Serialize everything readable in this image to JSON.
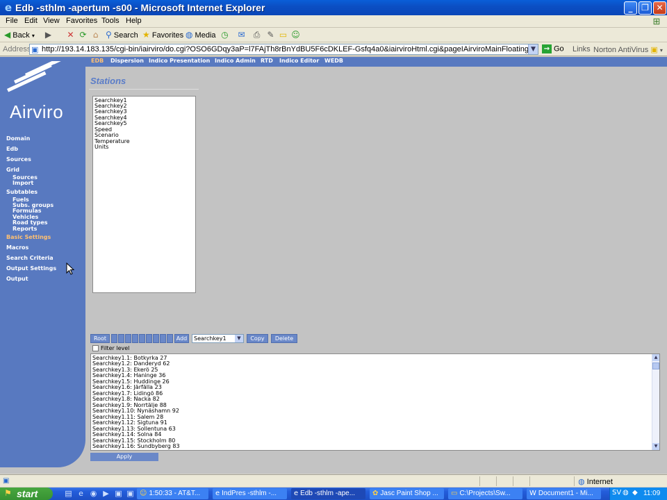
{
  "window": {
    "title": "Edb -sthlm -apertum -s00 - Microsoft Internet Explorer",
    "buttons": [
      "minimize",
      "restore",
      "close"
    ]
  },
  "menu": [
    "File",
    "Edit",
    "View",
    "Favorites",
    "Tools",
    "Help"
  ],
  "toolbar": {
    "back": "Back",
    "search": "Search",
    "favorites": "Favorites",
    "media": "Media"
  },
  "address": {
    "label": "Address",
    "url": "http://193.14.183.135/cgi-bin/iairviro/do.cgi?OSO6GDqy3aP=l7FAjTh8rBnYdBU5F6cDKLEF-Gsfq4a0&iairviroHtml.cgi&pageIAirviroMainFloatingModule&OSO6GDqy3al",
    "go": "Go",
    "links": "Links",
    "norton": "Norton AntiVirus"
  },
  "app": {
    "logo_text": "Airviro",
    "top_nav": [
      "EDB",
      "Dispersion",
      "Indico Presentation",
      "Indico Admin",
      "RTD",
      "Indico Editor",
      "WEDB"
    ],
    "top_nav_active": "EDB",
    "sidebar": {
      "domain": "Domain",
      "edb": "Edb",
      "sources": "Sources",
      "grid": "Grid",
      "grid_sources": "Sources",
      "grid_import": "Import",
      "subtables": "Subtables",
      "fuels": "Fuels",
      "subs_groups": "Subs. groups",
      "formulas": "Formulas",
      "vehicles": "Vehicles",
      "road_types": "Road types",
      "reports": "Reports",
      "basic_settings": "Basic Settings",
      "macros": "Macros",
      "search_criteria": "Search Criteria",
      "output_settings": "Output Settings",
      "output": "Output"
    },
    "page_title": "Stations",
    "stations": [
      "Searchkey1",
      "Searchkey2",
      "Searchkey3",
      "Searchkey4",
      "Searchkey5",
      "Speed",
      "Scenario",
      "Temperature",
      "Units"
    ],
    "controls": {
      "root": "Root",
      "add": "Add",
      "selected_key": "Searchkey1",
      "copy": "Copy",
      "delete": "Delete",
      "filter_level": "Filter level"
    },
    "results": [
      "Searchkey1.1: Botkyrka 27",
      "Searchkey1.2: Danderyd 62",
      "Searchkey1.3: Ekerö 25",
      "Searchkey1.4: Haninge 36",
      "Searchkey1.5: Huddinge 26",
      "Searchkey1.6: Järfälla 23",
      "Searchkey1.7: Lidingö 86",
      "Searchkey1.8: Nacka 82",
      "Searchkey1.9: Norrtälje 88",
      "Searchkey1.10: Nynäshamn 92",
      "Searchkey1.11: Salem 28",
      "Searchkey1.12: Sigtuna 91",
      "Searchkey1.13: Sollentuna 63",
      "Searchkey1.14: Solna 84",
      "Searchkey1.15: Stockholm 80",
      "Searchkey1.16: Sundbyberg 83"
    ],
    "apply": "Apply"
  },
  "status": {
    "zone": "Internet"
  },
  "taskbar": {
    "start": "start",
    "tasks": [
      "1:50:33 - AT&T...",
      "IndPres -sthlm -...",
      "Edb -sthlm -ape...",
      "Jasc Paint Shop ...",
      "C:\\Projects\\Sw...",
      "Document1 - Mi..."
    ],
    "tray_lang": "SV",
    "clock": "11:09"
  },
  "colors": {
    "title_bar": "#0a5fd8",
    "app_blue": "#5879c0",
    "app_accent": "#ffc072",
    "page_bg": "#c3c3c3"
  }
}
